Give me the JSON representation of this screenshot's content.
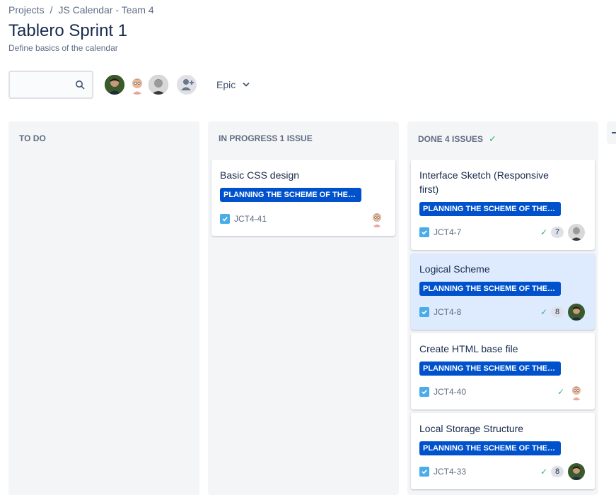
{
  "breadcrumb": {
    "projects": "Projects",
    "separator": "/",
    "project": "JS Calendar - Team 4"
  },
  "page": {
    "title": "Tablero Sprint 1",
    "subtitle": "Define basics of the calendar"
  },
  "search": {
    "placeholder": "",
    "value": "",
    "icon": "search-icon"
  },
  "filters": {
    "epic_label": "Epic"
  },
  "colors": {
    "epic_badge": "#0052cc",
    "done_check": "#36b37e",
    "column_bg": "#f4f5f7",
    "selected_card": "#deebff",
    "story_icon": "#4bade8"
  },
  "columns": [
    {
      "title": "TO DO",
      "cards": []
    },
    {
      "title": "IN PROGRESS 1 ISSUE",
      "cards": [
        {
          "summary": "Basic CSS design",
          "epic": "PLANNING THE SCHEME OF THE C...",
          "key": "JCT4-41",
          "assignee": "memoji-avatar"
        }
      ]
    },
    {
      "title": "DONE 4 ISSUES",
      "cards": [
        {
          "summary": "Interface Sketch (Responsive first)",
          "epic": "PLANNING THE SCHEME OF THE C...",
          "key": "JCT4-7",
          "points": "7",
          "assignee": "grey-avatar"
        },
        {
          "summary": "Logical Scheme",
          "epic": "PLANNING THE SCHEME OF THE C...",
          "key": "JCT4-8",
          "points": "8",
          "assignee": "dark-avatar",
          "selected": true
        },
        {
          "summary": "Create HTML base file",
          "epic": "PLANNING THE SCHEME OF THE C...",
          "key": "JCT4-40",
          "assignee": "memoji-avatar"
        },
        {
          "summary": "Local Storage Structure",
          "epic": "PLANNING THE SCHEME OF THE C...",
          "key": "JCT4-33",
          "points": "8",
          "assignee": "dark-avatar"
        }
      ]
    }
  ]
}
